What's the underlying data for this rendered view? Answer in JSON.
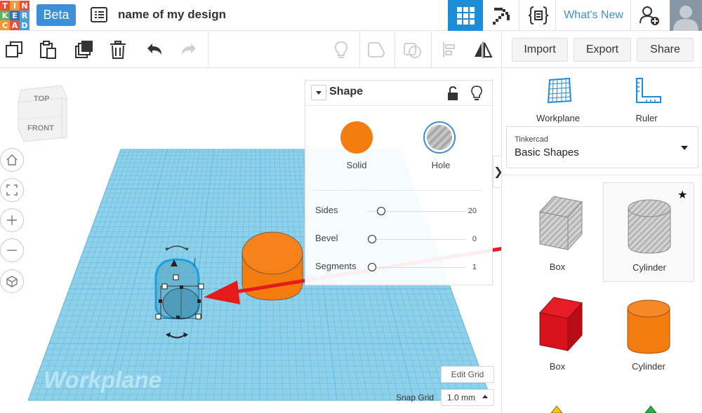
{
  "logo": {
    "letters": [
      "T",
      "I",
      "N",
      "K",
      "E",
      "R",
      "C",
      "A",
      "D"
    ],
    "colors": [
      "#e8503a",
      "#f19a34",
      "#f7c641",
      "#5fb15c",
      "#4aa1d8",
      "#3a6fb5",
      "#e8503a",
      "#f19a34",
      "#5fb15c"
    ]
  },
  "header": {
    "beta_label": "Beta",
    "design_name": "name of my design",
    "whats_new": "What's New"
  },
  "toolbar": {
    "import_label": "Import",
    "export_label": "Export",
    "share_label": "Share"
  },
  "viewcube": {
    "top": "TOP",
    "front": "FRONT"
  },
  "workplane": {
    "label": "Workplane",
    "edit_grid": "Edit Grid",
    "snap_grid_label": "Snap Grid",
    "snap_grid_value": "1.0 mm"
  },
  "shape_panel": {
    "title": "Shape",
    "solid_label": "Solid",
    "hole_label": "Hole",
    "solid_color": "#f47c0e",
    "properties": [
      {
        "label": "Sides",
        "value": "20",
        "knob": 0.1
      },
      {
        "label": "Bevel",
        "value": "0",
        "knob": 0.0
      },
      {
        "label": "Segments",
        "value": "1",
        "knob": 0.0
      }
    ]
  },
  "right_panel": {
    "workplane_label": "Workplane",
    "ruler_label": "Ruler",
    "library_small": "Tinkercad",
    "library_main": "Basic Shapes",
    "shapes": [
      {
        "label": "Box",
        "type": "box-hole"
      },
      {
        "label": "Cylinder",
        "type": "cylinder-hole"
      },
      {
        "label": "Box",
        "type": "box-solid"
      },
      {
        "label": "Cylinder",
        "type": "cylinder-solid"
      }
    ]
  },
  "colors": {
    "accent": "#1d8dd8",
    "grid": "#8fd0ea",
    "grid_line": "#5fb8dc",
    "orange": "#f47c0e",
    "red": "#d9121d",
    "arrow": "#e41b1b"
  }
}
